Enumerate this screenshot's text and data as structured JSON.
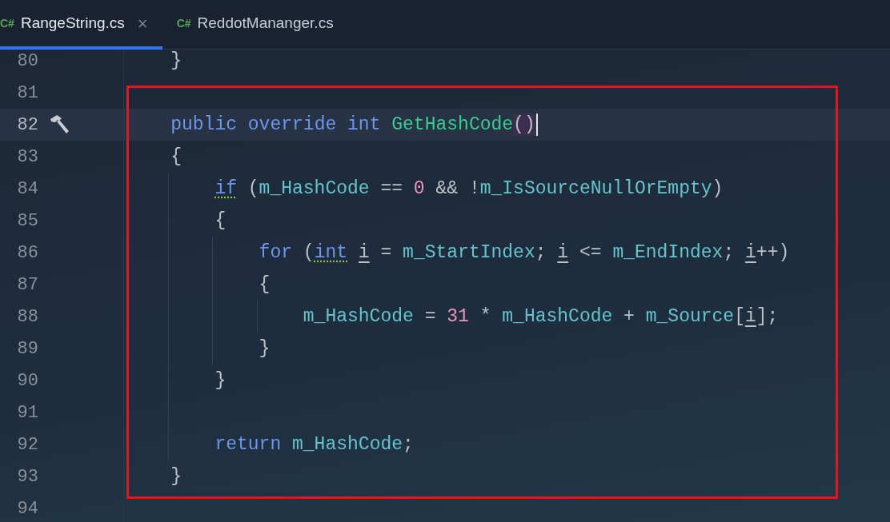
{
  "tabs": [
    {
      "icon": "C#",
      "label": "RangeString.cs",
      "close": "×",
      "selected": true
    },
    {
      "icon": "C#",
      "label": "ReddotMananger.cs",
      "selected": false
    }
  ],
  "lines": [
    {
      "number": "80",
      "current": false,
      "marker": false,
      "tokens": [
        {
          "kind": "plain",
          "text": "}"
        }
      ]
    },
    {
      "number": "81",
      "current": false,
      "marker": false
    },
    {
      "number": "82",
      "current": true,
      "marker": true,
      "tokens": [
        {
          "kind": "keyword",
          "text": "public "
        },
        {
          "kind": "keyword",
          "text": "override "
        },
        {
          "kind": "keyword",
          "text": "int "
        },
        {
          "kind": "method",
          "text": "GetHashCode"
        },
        {
          "kind": "brace",
          "text": "()"
        }
      ]
    },
    {
      "number": "83",
      "current": false,
      "marker": false,
      "tokens": [
        {
          "kind": "plain",
          "text": "{"
        }
      ],
      "children": [
        {
          "number": "84",
          "current": false,
          "marker": false,
          "tokens": [
            {
              "kind": "hint",
              "text": "if"
            },
            {
              "kind": "plain",
              "text": " ("
            },
            {
              "kind": "field",
              "text": "m_HashCode"
            },
            {
              "kind": "plain",
              "text": " == "
            },
            {
              "kind": "number",
              "text": "0"
            },
            {
              "kind": "plain",
              "text": " && !"
            },
            {
              "kind": "field",
              "text": "m_IsSourceNullOrEmpty"
            },
            {
              "kind": "plain",
              "text": ")"
            }
          ]
        },
        {
          "number": "85",
          "current": false,
          "marker": false,
          "tokens": [
            {
              "kind": "plain",
              "text": "{"
            }
          ],
          "children": [
            {
              "number": "86",
              "current": false,
              "marker": false,
              "tokens": [
                {
                  "kind": "keyword",
                  "text": "for"
                },
                {
                  "kind": "plain",
                  "text": " ("
                },
                {
                  "kind": "hint",
                  "text": "int"
                },
                {
                  "kind": "local",
                  "text": " i"
                },
                {
                  "kind": "plain",
                  "text": " = "
                },
                {
                  "kind": "field",
                  "text": "m_StartIndex"
                },
                {
                  "kind": "plain",
                  "text": "; "
                },
                {
                  "kind": "local",
                  "text": "i"
                },
                {
                  "kind": "plain",
                  "text": " <= "
                },
                {
                  "kind": "field",
                  "text": "m_EndIndex"
                },
                {
                  "kind": "plain",
                  "text": "; "
                },
                {
                  "kind": "local",
                  "text": "i"
                },
                {
                  "kind": "plain",
                  "text": "++)"
                }
              ]
            },
            {
              "number": "87",
              "current": false,
              "marker": false,
              "tokens": [
                {
                  "kind": "plain",
                  "text": "{"
                }
              ],
              "children": [
                {
                  "number": "88",
                  "current": false,
                  "marker": false,
                  "tokens": [
                    {
                      "kind": "field",
                      "text": "m_HashCode"
                    },
                    {
                      "kind": "plain",
                      "text": " = "
                    },
                    {
                      "kind": "number",
                      "text": "31"
                    },
                    {
                      "kind": "plain",
                      "text": " * "
                    },
                    {
                      "kind": "field",
                      "text": "m_HashCode"
                    },
                    {
                      "kind": "plain",
                      "text": " + "
                    },
                    {
                      "kind": "field",
                      "text": "m_Source"
                    },
                    {
                      "kind": "plain",
                      "text": "["
                    },
                    {
                      "kind": "local",
                      "text": "i"
                    },
                    {
                      "kind": "plain",
                      "text": "];"
                    }
                  ]
                }
              ]
            },
            {
              "number": "89",
              "current": false,
              "marker": false,
              "tokens": [
                {
                  "kind": "plain",
                  "text": "}"
                }
              ]
            }
          ]
        },
        {
          "number": "90",
          "current": false,
          "marker": false,
          "tokens": [
            {
              "kind": "plain",
              "text": "}"
            }
          ]
        },
        {
          "number": "91",
          "current": false,
          "marker": false
        },
        {
          "number": "92",
          "current": false,
          "marker": false,
          "tokens": [
            {
              "kind": "keyword",
              "text": "return "
            },
            {
              "kind": "field",
              "text": "m_HashCode"
            },
            {
              "kind": "plain",
              "text": ";"
            }
          ]
        }
      ]
    },
    {
      "number": "93",
      "current": false,
      "marker": false,
      "tokens": [
        {
          "kind": "plain",
          "text": "}"
        }
      ]
    },
    {
      "number": "94",
      "current": false,
      "marker": false
    }
  ]
}
